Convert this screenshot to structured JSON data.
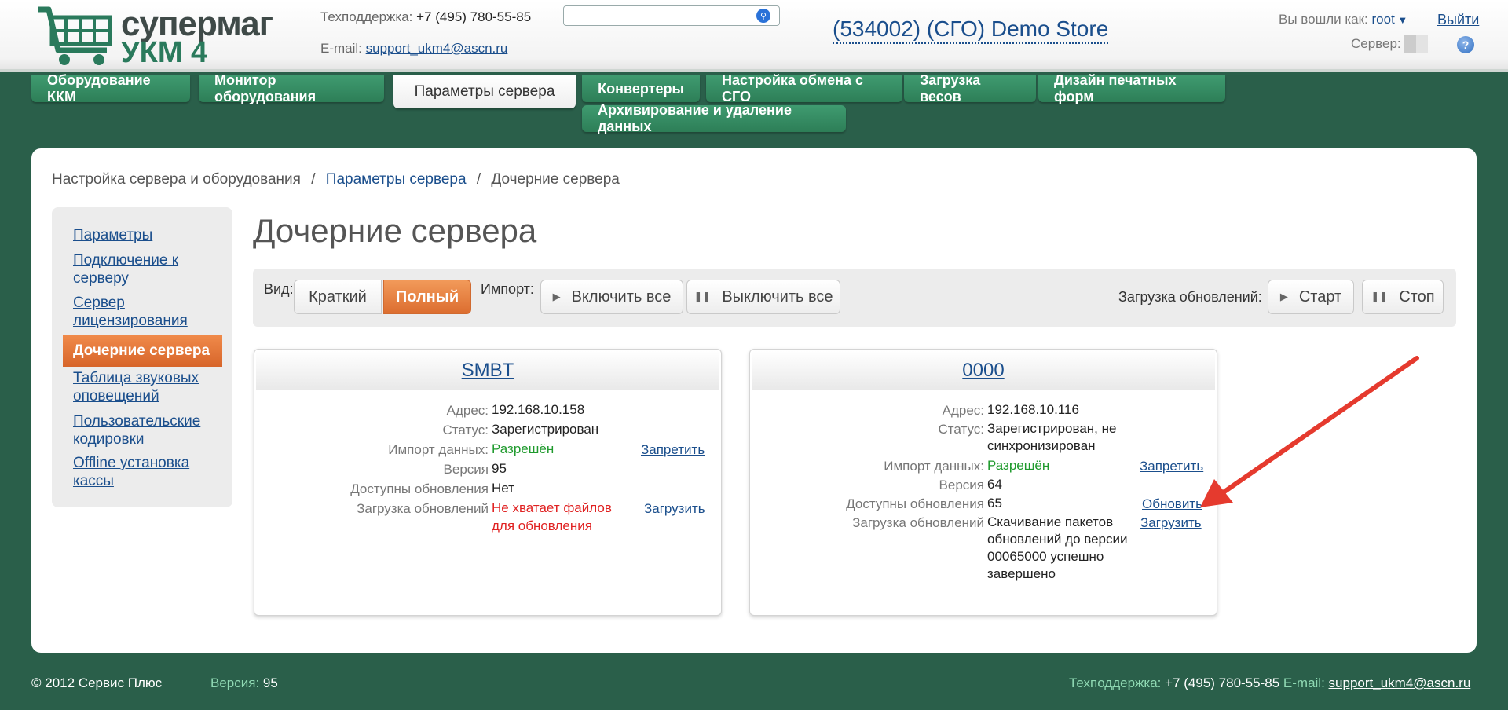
{
  "header": {
    "logo_line1": "супермаг",
    "logo_line2": "УКМ 4",
    "support_label": "Техподдержка:",
    "support_phone": "+7 (495) 780-55-85",
    "email_label": "E-mail:",
    "email": "support_ukm4@ascn.ru",
    "search_value": "",
    "store": "(534002) (СГО) Demo Store",
    "logged_as_label": "Вы вошли как:",
    "user": "root",
    "logout": "Выйти",
    "server_label": "Сервер:"
  },
  "nav": {
    "tabs": [
      "Оборудование ККМ",
      "Монитор оборудования",
      "Параметры сервера",
      "Конвертеры",
      "Настройка обмена с СГО",
      "Загрузка весов",
      "Дизайн печатных форм",
      "Архивирование и удаление данных"
    ],
    "active": "Параметры сервера"
  },
  "breadcrumb": {
    "item1": "Настройка сервера и оборудования",
    "item2": "Параметры сервера",
    "item3": "Дочерние сервера",
    "sep": "/"
  },
  "sidebar": {
    "items": [
      "Параметры",
      "Подключение к серверу",
      "Сервер лицензирования",
      "Дочерние сервера",
      "Таблица звуковых оповещений",
      "Пользовательские кодировки",
      "Offline установка кассы"
    ]
  },
  "page_title": "Дочерние сервера",
  "toolbar": {
    "view_label": "Вид:",
    "brief": "Краткий",
    "full": "Полный",
    "import_label": "Импорт:",
    "enable_all": "Включить все",
    "disable_all": "Выключить все",
    "updates_label": "Загрузка обновлений:",
    "start": "Старт",
    "stop": "Стоп"
  },
  "cards": [
    {
      "title": "SMBT",
      "labels": {
        "address": "Адрес:",
        "status": "Статус:",
        "import": "Импорт данных:",
        "version": "Версия",
        "updates": "Доступны обновления",
        "download": "Загрузка обновлений"
      },
      "address": "192.168.10.158",
      "status": "Зарегистрирован",
      "import": "Разрешён",
      "import_action": "Запретить",
      "version": "95",
      "updates": "Нет",
      "download_line1": "Не хватает файлов",
      "download_line2": "для обновления",
      "download_action": "Загрузить"
    },
    {
      "title": "0000",
      "labels": {
        "address": "Адрес:",
        "status": "Статус:",
        "import": "Импорт данных:",
        "version": "Версия",
        "updates": "Доступны обновления",
        "download": "Загрузка обновлений"
      },
      "address": "192.168.10.116",
      "status_line1": "Зарегистрирован, не",
      "status_line2": "синхронизирован",
      "import": "Разрешён",
      "import_action": "Запретить",
      "version": "64",
      "updates": "65",
      "updates_action": "Обновить",
      "download_line1": "Скачивание пакетов",
      "download_line2": "обновлений до версии",
      "download_line3": "00065000 успешно",
      "download_line4": "завершено",
      "download_action": "Загрузить"
    }
  ],
  "footer": {
    "copyright": "© 2012 Сервис Плюс",
    "version_label": "Версия:",
    "version": "95",
    "support_label": "Техподдержка:",
    "phone": "+7 (495) 780-55-85",
    "email_label": "E-mail:",
    "email": "support_ukm4@ascn.ru"
  },
  "colors": {
    "background": "#2a5f4a",
    "tab": "#3f9b70",
    "active_orange": "#e8783a",
    "link": "#1a4e8c",
    "arrow": "#e53a2e"
  }
}
